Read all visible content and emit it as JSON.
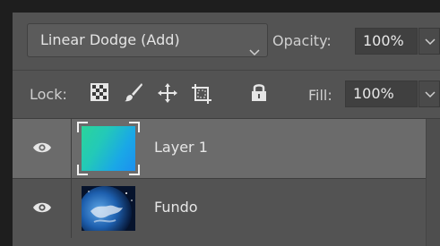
{
  "blend": {
    "mode": "Linear Dodge (Add)",
    "icon": "chevron-down-icon"
  },
  "opacity": {
    "label": "Opacity:",
    "value": "100%"
  },
  "lock": {
    "label": "Lock:",
    "icons": [
      "lock-transparent-pixels-icon",
      "lock-image-pixels-icon",
      "lock-position-icon",
      "prevent-artboard-nesting-icon",
      "lock-all-icon"
    ]
  },
  "fill": {
    "label": "Fill:",
    "value": "100%"
  },
  "layers": [
    {
      "name": "Layer 1",
      "visible": true,
      "selected": true,
      "thumbnail": "gradient-thumbnail"
    },
    {
      "name": "Fundo",
      "visible": true,
      "selected": false,
      "thumbnail": "earth-thumbnail"
    }
  ],
  "colors": {
    "panel_bg": "#535353",
    "selected_row": "#6b6b6b",
    "gradient_start": "#2bd59a",
    "gradient_end": "#1c8ff0"
  }
}
